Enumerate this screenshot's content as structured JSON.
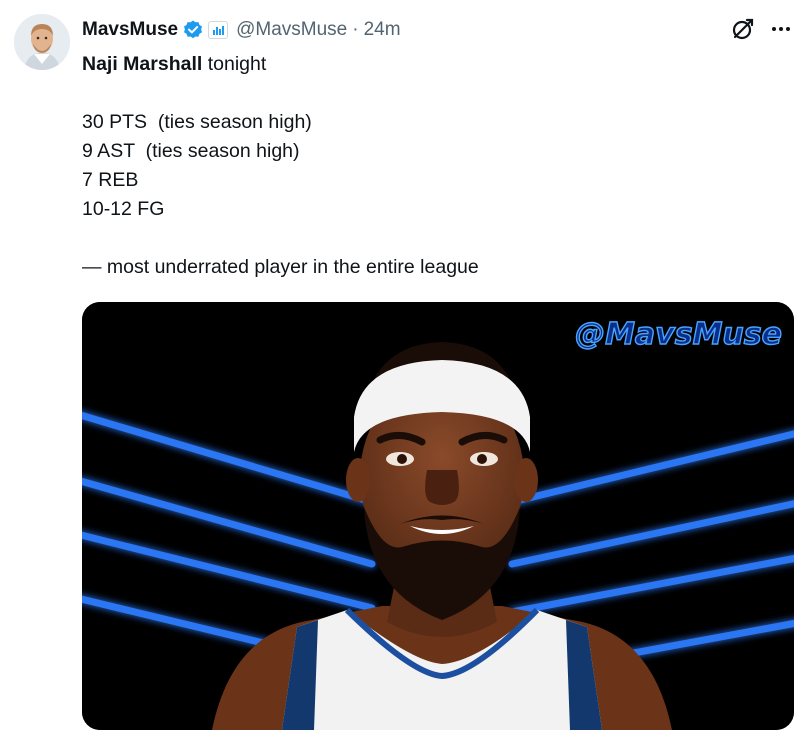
{
  "tweet": {
    "display_name": "MavsMuse",
    "handle": "@MavsMuse",
    "separator": "·",
    "time": "24m",
    "lines": [
      {
        "bold": "Naji Marshall",
        "rest": " tonight"
      },
      {
        "text": ""
      },
      {
        "text": "30 PTS  (ties season high)"
      },
      {
        "text": "9 AST  (ties season high)"
      },
      {
        "text": "7 REB"
      },
      {
        "text": "10-12 FG"
      },
      {
        "text": ""
      },
      {
        "text": "— most underrated player in the entire league"
      }
    ],
    "media": {
      "watermark": "@MavsMuse",
      "description_icon": "player-cartoon-image"
    }
  },
  "icons": {
    "verified": "verified-badge-icon",
    "affiliate": "affiliate-badge-icon",
    "grok": "grok-icon",
    "more": "more-options-icon"
  },
  "colors": {
    "accent": "#1d9bf0",
    "neon": "#1e6cff",
    "text": "#0f1419",
    "muted": "#536471"
  }
}
